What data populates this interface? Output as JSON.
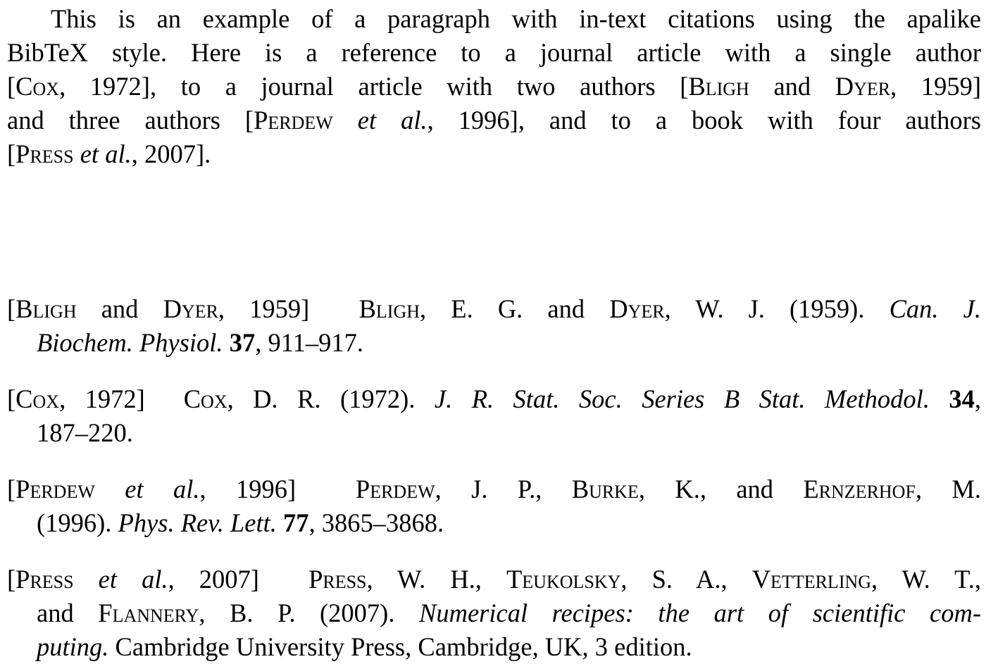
{
  "paragraph": {
    "lines": [
      [
        "This is an example of a paragraph with in-text citations using the apalike"
      ],
      [
        "BibTeX style.  Here is a reference to a journal article with a single author"
      ],
      [
        "[",
        "Cox",
        ", 1972], to a journal article with two authors [",
        "Bligh",
        " and ",
        "Dyer",
        ", 1959]"
      ],
      [
        "and three authors [",
        "Perdew",
        " ",
        "et al.",
        ", 1996], and to a book with four authors"
      ],
      [
        "[",
        "Press",
        " ",
        "et al.",
        ", 2007]."
      ]
    ]
  },
  "bibliography": {
    "entries": [
      {
        "key_parts": [
          "[",
          "Bligh",
          " and ",
          "Dyer",
          ", 1959]"
        ],
        "line1": [
          "Bligh",
          ", E. G. and ",
          "Dyer",
          ", W. J. (1959). ",
          "Can. J."
        ],
        "line2": [
          "Biochem. Physiol.",
          " ",
          "37",
          ", 911–917."
        ]
      },
      {
        "key_parts": [
          "[",
          "Cox",
          ", 1972]"
        ],
        "line1": [
          "Cox",
          ", D. R. (1972). ",
          "J. R. Stat. Soc. Series B Stat. Methodol.",
          " ",
          "34",
          ","
        ],
        "line2": [
          "187–220."
        ]
      },
      {
        "key_parts": [
          "[",
          "Perdew",
          " ",
          "et al.",
          ", 1996]"
        ],
        "line1": [
          "Perdew",
          ", J. P., ",
          "Burke",
          ", K., and ",
          "Ernzerhof",
          ", M."
        ],
        "line2": [
          "(1996). ",
          "Phys. Rev. Lett.",
          " ",
          "77",
          ", 3865–3868."
        ]
      },
      {
        "key_parts": [
          "[",
          "Press",
          " ",
          "et al.",
          ", 2007]"
        ],
        "line1": [
          "Press",
          ", W. H., ",
          "Teukolsky",
          ", S. A., ",
          "Vetterling",
          ", W. T.,"
        ],
        "line2": [
          "and ",
          "Flannery",
          ", B. P. (2007). ",
          "Numerical recipes: the art of scientific com-"
        ],
        "line3": [
          "puting.",
          " Cambridge University Press, Cambridge, UK, 3 edition."
        ]
      }
    ]
  }
}
